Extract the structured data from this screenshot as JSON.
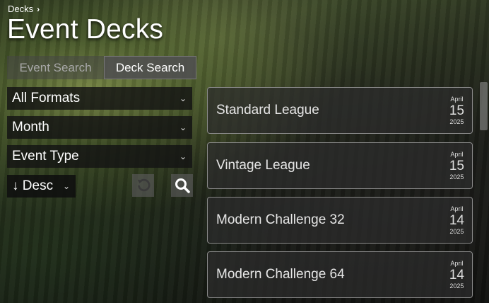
{
  "breadcrumb": {
    "label": "Decks"
  },
  "page": {
    "title": "Event Decks"
  },
  "tabs": [
    {
      "label": "Event Search",
      "active": false
    },
    {
      "label": "Deck Search",
      "active": true
    }
  ],
  "filters": {
    "format": "All Formats",
    "month": "Month",
    "event_type": "Event Type",
    "sort": "↓ Desc"
  },
  "icons": {
    "breadcrumb_chevron": "chevron-right-icon",
    "dropdown_caret": "chevron-down-icon",
    "reset": "reset-icon",
    "search": "search-icon"
  },
  "events": [
    {
      "name": "Standard League",
      "month": "April",
      "day": "15",
      "year": "2025"
    },
    {
      "name": "Vintage League",
      "month": "April",
      "day": "15",
      "year": "2025"
    },
    {
      "name": "Modern Challenge 32",
      "month": "April",
      "day": "14",
      "year": "2025"
    },
    {
      "name": "Modern Challenge 64",
      "month": "April",
      "day": "14",
      "year": "2025"
    }
  ]
}
